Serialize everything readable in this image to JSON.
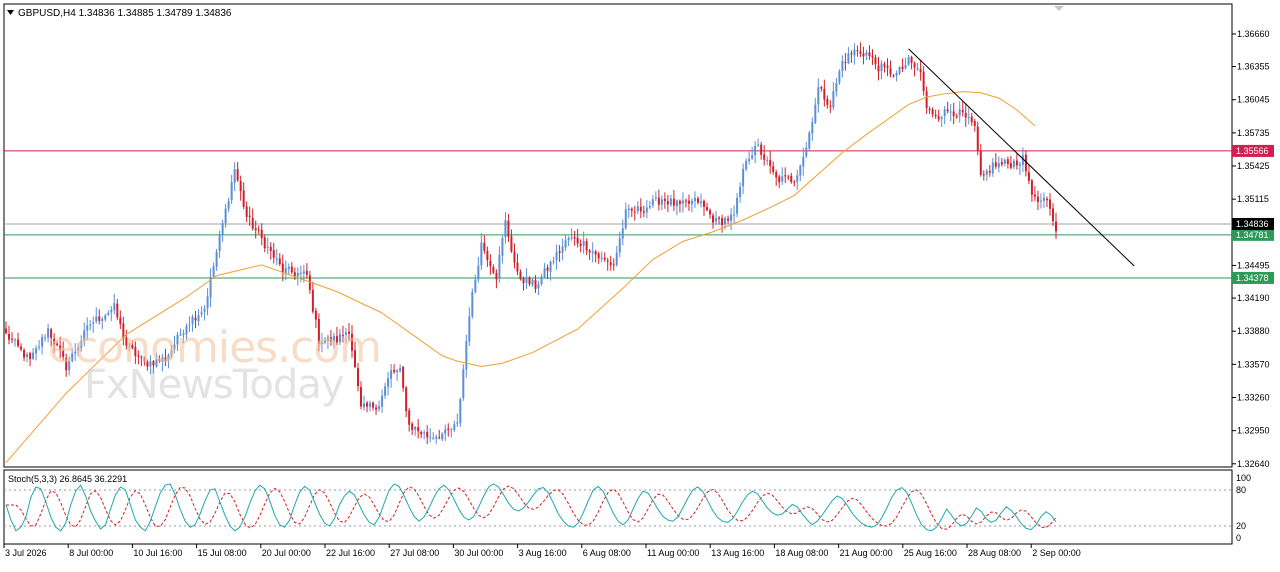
{
  "header": {
    "symbol": "GBPUSD,H4",
    "ohlc": "1.34836 1.34885 1.34789 1.34836"
  },
  "indicator": {
    "label": "Stoch(5,3,3) 26.8645 36.2291",
    "levels": [
      "100",
      "80",
      "20",
      "0"
    ]
  },
  "watermark": {
    "line1": "economies.com",
    "line2": "FxNewsToday"
  },
  "colors": {
    "bull": "#5b8fd6",
    "bear": "#d2202a",
    "ma": "#f0a030",
    "resistance": "#d02050",
    "support": "#2e9a5a",
    "trendline": "#000000",
    "stoch_main": "#20a8b0",
    "stoch_signal": "#d02020"
  },
  "chart_data": {
    "type": "candlestick",
    "price_ticks": [
      "1.36660",
      "1.36355",
      "1.36045",
      "1.35735",
      "1.35425",
      "1.35115",
      "1.34495",
      "1.34190",
      "1.33880",
      "1.33570",
      "1.33260",
      "1.32950",
      "1.32640"
    ],
    "price_tick_values": [
      1.3666,
      1.36355,
      1.36045,
      1.35735,
      1.35425,
      1.35115,
      1.34495,
      1.3419,
      1.3388,
      1.3357,
      1.3326,
      1.3295,
      1.3264
    ],
    "ylim": [
      1.3261,
      1.3694
    ],
    "time_labels": [
      "3 Jul 2026",
      "8 Jul 00:00",
      "10 Jul 16:00",
      "15 Jul 08:00",
      "20 Jul 00:00",
      "22 Jul 16:00",
      "27 Jul 08:00",
      "30 Jul 00:00",
      "3 Aug 16:00",
      "6 Aug 08:00",
      "11 Aug 00:00",
      "13 Aug 16:00",
      "18 Aug 08:00",
      "21 Aug 00:00",
      "25 Aug 16:00",
      "28 Aug 08:00",
      "2 Sep 00:00"
    ],
    "horizontal_levels": [
      {
        "label": "1.35566",
        "value": 1.35566,
        "role": "resistance"
      },
      {
        "label": "1.34781",
        "value": 1.34781,
        "role": "support"
      },
      {
        "label": "1.34378",
        "value": 1.34378,
        "role": "support"
      }
    ],
    "current_price": {
      "label": "1.34836",
      "value": 1.34836
    },
    "trendline": {
      "from": {
        "bar": 300,
        "price": 1.3652
      },
      "to": {
        "bar": 375,
        "price": 1.3449
      }
    },
    "anchors": [
      [
        0,
        1.3385
      ],
      [
        8,
        1.336
      ],
      [
        14,
        1.339
      ],
      [
        20,
        1.3355
      ],
      [
        28,
        1.3395
      ],
      [
        36,
        1.341
      ],
      [
        40,
        1.3375
      ],
      [
        46,
        1.3358
      ],
      [
        53,
        1.3362
      ],
      [
        60,
        1.3395
      ],
      [
        66,
        1.341
      ],
      [
        70,
        1.3462
      ],
      [
        76,
        1.354
      ],
      [
        80,
        1.3495
      ],
      [
        86,
        1.347
      ],
      [
        92,
        1.3445
      ],
      [
        100,
        1.344
      ],
      [
        104,
        1.338
      ],
      [
        110,
        1.338
      ],
      [
        114,
        1.339
      ],
      [
        118,
        1.3315
      ],
      [
        124,
        1.332
      ],
      [
        128,
        1.335
      ],
      [
        131,
        1.335
      ],
      [
        134,
        1.33
      ],
      [
        140,
        1.329
      ],
      [
        146,
        1.3292
      ],
      [
        150,
        1.33
      ],
      [
        154,
        1.3405
      ],
      [
        158,
        1.347
      ],
      [
        163,
        1.344
      ],
      [
        166,
        1.349
      ],
      [
        170,
        1.344
      ],
      [
        176,
        1.343
      ],
      [
        182,
        1.3455
      ],
      [
        187,
        1.3475
      ],
      [
        192,
        1.347
      ],
      [
        198,
        1.3455
      ],
      [
        202,
        1.345
      ],
      [
        206,
        1.3498
      ],
      [
        212,
        1.3503
      ],
      [
        218,
        1.3512
      ],
      [
        224,
        1.3505
      ],
      [
        230,
        1.351
      ],
      [
        236,
        1.349
      ],
      [
        242,
        1.3495
      ],
      [
        246,
        1.355
      ],
      [
        250,
        1.356
      ],
      [
        256,
        1.353
      ],
      [
        262,
        1.353
      ],
      [
        266,
        1.356
      ],
      [
        270,
        1.3615
      ],
      [
        274,
        1.36
      ],
      [
        278,
        1.364
      ],
      [
        282,
        1.365
      ],
      [
        286,
        1.3648
      ],
      [
        290,
        1.3635
      ],
      [
        296,
        1.3628
      ],
      [
        300,
        1.364
      ],
      [
        304,
        1.363
      ],
      [
        306,
        1.3595
      ],
      [
        310,
        1.359
      ],
      [
        314,
        1.3595
      ],
      [
        318,
        1.359
      ],
      [
        322,
        1.3578
      ],
      [
        324,
        1.353
      ],
      [
        328,
        1.3543
      ],
      [
        334,
        1.3545
      ],
      [
        338,
        1.3548
      ],
      [
        342,
        1.351
      ],
      [
        346,
        1.3508
      ],
      [
        349,
        1.3484
      ]
    ],
    "moving_average": [
      [
        0,
        1.3265
      ],
      [
        20,
        1.333
      ],
      [
        40,
        1.3385
      ],
      [
        60,
        1.342
      ],
      [
        70,
        1.344
      ],
      [
        85,
        1.345
      ],
      [
        95,
        1.344
      ],
      [
        110,
        1.3425
      ],
      [
        125,
        1.3405
      ],
      [
        135,
        1.3385
      ],
      [
        145,
        1.3365
      ],
      [
        150,
        1.336
      ],
      [
        158,
        1.3355
      ],
      [
        165,
        1.3358
      ],
      [
        175,
        1.3368
      ],
      [
        190,
        1.339
      ],
      [
        205,
        1.3428
      ],
      [
        215,
        1.3455
      ],
      [
        225,
        1.3472
      ],
      [
        235,
        1.3481
      ],
      [
        245,
        1.3492
      ],
      [
        255,
        1.3505
      ],
      [
        262,
        1.3515
      ],
      [
        270,
        1.3535
      ],
      [
        278,
        1.3555
      ],
      [
        286,
        1.3572
      ],
      [
        294,
        1.3588
      ],
      [
        300,
        1.36
      ],
      [
        306,
        1.3607
      ],
      [
        312,
        1.361
      ],
      [
        318,
        1.3612
      ],
      [
        324,
        1.3611
      ],
      [
        330,
        1.3606
      ],
      [
        336,
        1.3595
      ],
      [
        342,
        1.358
      ]
    ],
    "stochastic": {
      "values": [
        55,
        30,
        12,
        18,
        35,
        68,
        85,
        82,
        60,
        35,
        18,
        12,
        25,
        55,
        78,
        88,
        70,
        45,
        28,
        15,
        22,
        48,
        72,
        85,
        80,
        55,
        30,
        18,
        12,
        28,
        52,
        75,
        88,
        90,
        72,
        48,
        28,
        18,
        22,
        40,
        62,
        80,
        82,
        60,
        38,
        20,
        12,
        18,
        35,
        58,
        78,
        88,
        82,
        62,
        38,
        22,
        18,
        30,
        55,
        76,
        86,
        80,
        60,
        40,
        25,
        20,
        32,
        55,
        70,
        78,
        72,
        55,
        38,
        26,
        22,
        35,
        58,
        80,
        90,
        86,
        70,
        52,
        36,
        28,
        35,
        50,
        68,
        82,
        88,
        80,
        65,
        48,
        35,
        30,
        36,
        52,
        70,
        85,
        90,
        85,
        72,
        58,
        48,
        45,
        50,
        60,
        72,
        82,
        84,
        75,
        58,
        40,
        28,
        20,
        18,
        25,
        42,
        62,
        80,
        86,
        78,
        60,
        42,
        28,
        22,
        30,
        48,
        66,
        78,
        75,
        62,
        48,
        36,
        30,
        28,
        35,
        50,
        66,
        80,
        85,
        78,
        62,
        46,
        34,
        28,
        26,
        32,
        45,
        60,
        72,
        78,
        74,
        62,
        50,
        42,
        38,
        40,
        48,
        56,
        52,
        40,
        30,
        22,
        28,
        38,
        50,
        62,
        70,
        66,
        55,
        42,
        32,
        24,
        20,
        18,
        22,
        34,
        50,
        68,
        80,
        84,
        76,
        58,
        38,
        22,
        14,
        12,
        18,
        32,
        48,
        38,
        26,
        20,
        24,
        36,
        50,
        44,
        32,
        26,
        30,
        42,
        52,
        46,
        36,
        24,
        16,
        14,
        22,
        36,
        44,
        38,
        26.86
      ],
      "signal_lag": 2,
      "levels": [
        80,
        20
      ],
      "range": [
        0,
        100
      ]
    }
  }
}
